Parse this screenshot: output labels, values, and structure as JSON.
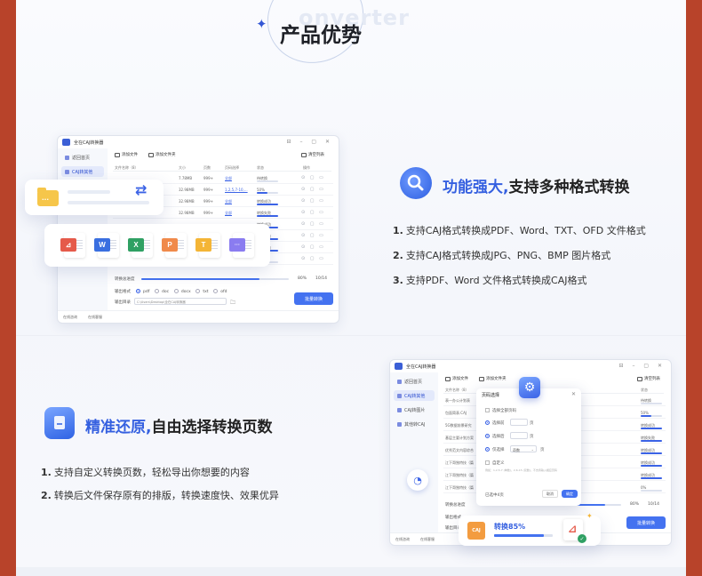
{
  "header": {
    "title": "产品优势",
    "watermark": "onverter"
  },
  "app": {
    "title": "全在CAJ转换器",
    "sidebar": [
      "返回首页",
      "CAJ转其他",
      "CAJ转图片",
      "其他转CAJ"
    ],
    "toolbar": [
      "添加文件",
      "添加文件夹"
    ],
    "clear": "清空列表",
    "columns": [
      "文件名称（8）",
      "大小",
      "页数",
      "页码选择",
      "状态",
      "操作"
    ],
    "rows": [
      {
        "size": "7.78MB",
        "pages": "999+",
        "range": "全部",
        "status": "待转换",
        "pct": 0
      },
      {
        "size": "32.98MB",
        "pages": "999+",
        "range": "1,2,5,7-10,...",
        "status": "50%",
        "pct": 50
      },
      {
        "size": "32.98MB",
        "pages": "999+",
        "range": "全部",
        "status": "转换成功",
        "pct": 100
      },
      {
        "size": "32.98MB",
        "pages": "999+",
        "range": "全部",
        "status": "转换失败",
        "pct": 100
      },
      {
        "size": "",
        "pages": "",
        "range": "",
        "status": "转换成功",
        "pct": 100
      },
      {
        "size": "",
        "pages": "",
        "range": "",
        "status": "转换成功",
        "pct": 100
      },
      {
        "size": "",
        "pages": "",
        "range": "",
        "status": "转换成功",
        "pct": 100
      },
      {
        "size": "",
        "pages": "",
        "range": "",
        "status": "0%",
        "pct": 0
      }
    ],
    "overall_label": "转换总进度",
    "overall_pct": "80%",
    "overall_count": "10/14",
    "output_format_label": "输出格式",
    "formats": [
      "pdf",
      "doc",
      "docx",
      "txt",
      "ofd"
    ],
    "selected_format": "pdf",
    "output_dir_label": "输出目录",
    "output_dir": "C:\\Users\\Desktop\\全在CAJ转换器",
    "batch_button": "批量转换",
    "footer": [
      "在线咨询",
      "在线客服"
    ]
  },
  "formats_card": [
    "PDF",
    "W",
    "X",
    "P",
    "T",
    "···"
  ],
  "feature1": {
    "title_hl": "功能强大,",
    "title_rest": "支持多种格式转换",
    "items": [
      {
        "n": "1.",
        "text": "支持CAJ格式转换成PDF、Word、TXT、OFD 文件格式"
      },
      {
        "n": "2.",
        "text": "支持CAJ格式转换成JPG、PNG、BMP 图片格式"
      },
      {
        "n": "3.",
        "text": "支持PDF、Word 文件格式转换成CAJ格式"
      }
    ]
  },
  "feature2": {
    "title_hl": "精准还原,",
    "title_rest": "自由选择转换页数",
    "items": [
      {
        "n": "1.",
        "text": "支持自定义转换页数，轻松导出你想要的内容"
      },
      {
        "n": "2.",
        "text": "转换后文件保存原有的排版，转换速度快、效果优异"
      }
    ]
  },
  "dialog": {
    "title": "页码选择",
    "select_all": "选择全部页码",
    "opt1": "选择前",
    "opt2": "选择后",
    "opt3": "仅选择",
    "unit": "页",
    "range_sel": "奇数",
    "custom": "自定义",
    "custom_hint": "例如：1,2,5-7 (单数)，2,6-15 (双数)，不支持输入相应页码",
    "selected_count": "已选中4页",
    "cancel": "取消",
    "ok": "确定"
  },
  "app2_rows": [
    "表一办公计划表",
    "包面简表.CAJ",
    "5G数据前景研究",
    "基层主要计划方案",
    "优秀范文内容综合",
    "江下哥独特技（篇",
    "江下哥独特技（篇",
    "江下哥独特技（篇"
  ],
  "app2_status": [
    "待转换",
    "50%",
    "转换成功",
    "转换失败",
    "转换成功",
    "转换成功",
    "转换成功",
    "0%"
  ],
  "toast": {
    "label": "转换85%",
    "pct": 0.85,
    "src": "CAJ",
    "dst": "PDF"
  }
}
